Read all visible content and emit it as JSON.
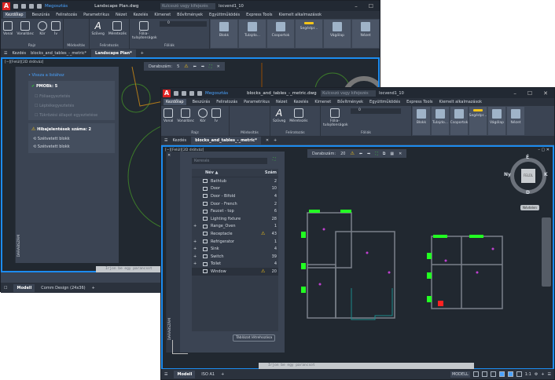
{
  "app_logo": "A",
  "share_label": "Megosztás",
  "search_placeholder": "Kulcsszó vagy kifejezés",
  "user": "locvend1_10",
  "ribbon_tabs": [
    "Kezdőlap",
    "Beszúrás",
    "Feliratozás",
    "Parametrikus",
    "Nézet",
    "Kezelés",
    "Kimenet",
    "Bővítmények",
    "Együttműködés",
    "Express Tools",
    "Kiemelt alkalmazások"
  ],
  "ribbon": {
    "draw_tools": [
      "Vonal",
      "Vonallánc",
      "Kör",
      "Ív"
    ],
    "draw_label": "Rajz",
    "modify_label": "Módosítás",
    "annot_tools": [
      "Szöveg",
      "Méretezés"
    ],
    "annot_label": "Feliratozás",
    "layer_props": "Fólia-tulajdonságok",
    "layer_current": "0",
    "layers_label": "Fóliák",
    "big_buttons": [
      "Blokk",
      "Tulajdo...",
      "Csoportok",
      "Segédpr...",
      "Vágólap",
      "Nézet"
    ]
  },
  "back": {
    "title": "Landscape Plan.dwg",
    "file_tabs": [
      "Kezdés",
      "blocks_and_tables_-_metric*",
      "Landscape Plan*"
    ],
    "viewport_label": "[−][Felül][2D drótváz]",
    "count_label": "Darabszám:",
    "count_value": "5",
    "panel": {
      "back_link": "• Vissza a listához",
      "pmoBk": "PMOBk: 5",
      "checks": [
        "Fóliaegyeztetés",
        "Léptékegyeztetés",
        "Tükrözési állapot egyeztetése"
      ],
      "errors_title": "Hibajelentések száma: 2",
      "errors": [
        "Szétvetett blokk",
        "Szétvetett blokk"
      ],
      "palette_title": "DARABSZÁM"
    },
    "command_placeholder": "Írjon be egy parancsot",
    "layout_tabs": [
      "Modell",
      "Comm Design (24x36)"
    ]
  },
  "front": {
    "title": "blocks_and_tables_-_metric.dwg",
    "file_tabs": [
      "Kezdés",
      "blocks_and_tables_-_metric*"
    ],
    "viewport_label": "[−][Felül][2D drótváz]",
    "count_label": "Darabszám:",
    "count_value": "20",
    "panel": {
      "search_placeholder": "Keresés",
      "col_name": "Név ▲",
      "col_count": "Szám",
      "rows": [
        {
          "name": "Bathtub",
          "count": "2",
          "expand": false,
          "warn": false
        },
        {
          "name": "Door",
          "count": "10",
          "expand": false,
          "warn": false
        },
        {
          "name": "Door - Bifold",
          "count": "4",
          "expand": false,
          "warn": false
        },
        {
          "name": "Door - French",
          "count": "2",
          "expand": false,
          "warn": false
        },
        {
          "name": "Faucet - top",
          "count": "6",
          "expand": false,
          "warn": false
        },
        {
          "name": "Lighting fixture",
          "count": "28",
          "expand": false,
          "warn": false
        },
        {
          "name": "Range_Oven",
          "count": "1",
          "expand": true,
          "warn": false
        },
        {
          "name": "Receptacle",
          "count": "43",
          "expand": false,
          "warn": true
        },
        {
          "name": "Refrigerator",
          "count": "1",
          "expand": true,
          "warn": false
        },
        {
          "name": "Sink",
          "count": "4",
          "expand": true,
          "warn": false
        },
        {
          "name": "Switch",
          "count": "39",
          "expand": true,
          "warn": false
        },
        {
          "name": "Toilet",
          "count": "4",
          "expand": true,
          "warn": false
        },
        {
          "name": "Window",
          "count": "20",
          "expand": false,
          "warn": true,
          "selected": true
        }
      ],
      "create_table": "Táblázat létrehozása",
      "palette_title": "DARABSZÁM"
    },
    "viewcube": {
      "top": "FELÜL",
      "n": "É",
      "s": "D",
      "e": "K",
      "w": "Ny",
      "ucs": "Névtelen"
    },
    "command_placeholder": "Írjon be egy parancsot",
    "layout_tabs": [
      "Modell",
      "ISO A1"
    ],
    "status_model": "MODELL",
    "status_scale": "1:1"
  },
  "colors": {
    "accent": "#1c8cf0",
    "viewport_bg": "#212830",
    "ui_bg": "#3b4453",
    "highlight_green": "#22ff22",
    "warning": "#f5c518"
  }
}
